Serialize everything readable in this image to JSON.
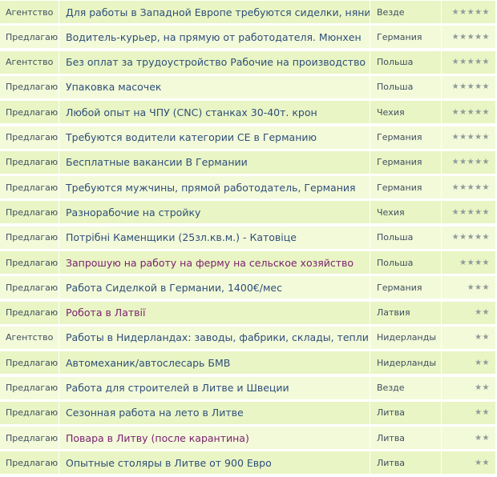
{
  "listings": [
    {
      "type": "Агентство",
      "title": "Для работы в Западной Европе требуются сиделки, няни",
      "country": "Везде",
      "rating": "★★★★★",
      "stars": 5,
      "visited": false
    },
    {
      "type": "Предлагаю",
      "title": "Водитель-курьер, на прямую от работодателя. Мюнхен",
      "country": "Германия",
      "rating": "★★★★★",
      "stars": 5,
      "visited": false
    },
    {
      "type": "Агентство",
      "title": "Без оплат за трудоустройство Рабочие на производство",
      "country": "Польша",
      "rating": "★★★★★",
      "stars": 5,
      "visited": false
    },
    {
      "type": "Предлагаю",
      "title": "Упаковка масочек",
      "country": "Польша",
      "rating": "★★★★★",
      "stars": 5,
      "visited": false
    },
    {
      "type": "Предлагаю",
      "title": "Любой опыт на ЧПУ (CNC) станках 30-40т. крон",
      "country": "Чехия",
      "rating": "★★★★★",
      "stars": 5,
      "visited": false
    },
    {
      "type": "Предлагаю",
      "title": "Требуются водители категории СЕ в Германию",
      "country": "Германия",
      "rating": "★★★★★",
      "stars": 5,
      "visited": false
    },
    {
      "type": "Предлагаю",
      "title": "Бесплатные вакансии В Германии",
      "country": "Германия",
      "rating": "★★★★★",
      "stars": 5,
      "visited": false
    },
    {
      "type": "Предлагаю",
      "title": "Требуются мужчины, прямой работодатель, Германия",
      "country": "Германия",
      "rating": "★★★★★",
      "stars": 5,
      "visited": false
    },
    {
      "type": "Предлагаю",
      "title": "Разнорабочие на стройку",
      "country": "Чехия",
      "rating": "★★★★★",
      "stars": 5,
      "visited": false
    },
    {
      "type": "Предлагаю",
      "title": "Потрібні Каменщики (25зл.кв.м.) - Катовіце",
      "country": "Польша",
      "rating": "★★★★★",
      "stars": 5,
      "visited": false
    },
    {
      "type": "Предлагаю",
      "title": "Запрошую на работу на ферму на сельское хозяйство",
      "country": "Польша",
      "rating": "★★★★",
      "stars": 4,
      "visited": true
    },
    {
      "type": "Предлагаю",
      "title": "Работа Сиделкой в Германии, 1400€/мес",
      "country": "Германия",
      "rating": "★★★",
      "stars": 3,
      "visited": false
    },
    {
      "type": "Предлагаю",
      "title": "Робота в Латвії",
      "country": "Латвия",
      "rating": "★★",
      "stars": 2,
      "visited": true
    },
    {
      "type": "Агентство",
      "title": "Работы в Нидерландах: заводы, фабрики, склады, теплицы...",
      "country": "Нидерланды",
      "rating": "★★",
      "stars": 2,
      "visited": false
    },
    {
      "type": "Предлагаю",
      "title": "Автомеханик/автослесарь БМВ",
      "country": "Нидерланды",
      "rating": "★★",
      "stars": 2,
      "visited": false
    },
    {
      "type": "Предлагаю",
      "title": "Работа для строителей в Литве и Швеции",
      "country": "Везде",
      "rating": "★★",
      "stars": 2,
      "visited": false
    },
    {
      "type": "Предлагаю",
      "title": "Сезонная работа на лето в Литве",
      "country": "Литва",
      "rating": "★★",
      "stars": 2,
      "visited": false
    },
    {
      "type": "Предлагаю",
      "title": "Повара в Литву (после карантина)",
      "country": "Литва",
      "rating": "★★",
      "stars": 2,
      "visited": true
    },
    {
      "type": "Предлагаю",
      "title": "Опытные столяры в Литве от 900 Евро",
      "country": "Литва",
      "rating": "★★",
      "stars": 2,
      "visited": false
    }
  ],
  "colors": {
    "row_odd": "#e9f5c4",
    "row_even": "#f3fad9",
    "link": "#2e4e7b",
    "link_visited": "#7a1f6f",
    "meta_text": "#3f4f60",
    "star": "#8f9a99"
  }
}
